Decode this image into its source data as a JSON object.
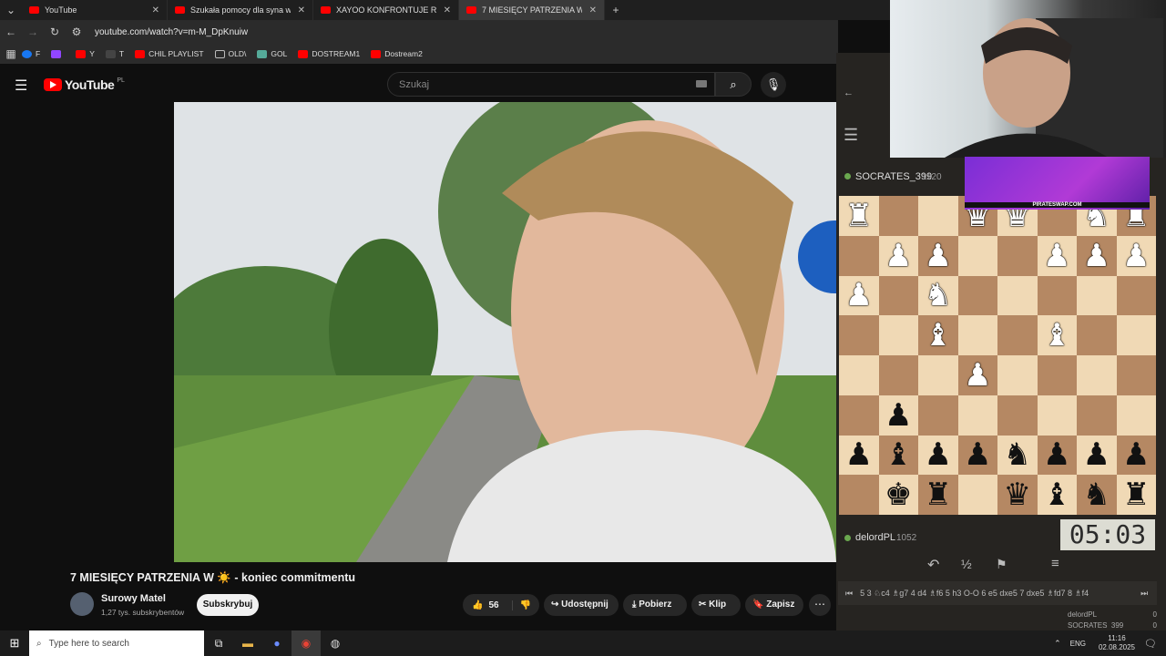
{
  "tabs": [
    {
      "label": "YouTube"
    },
    {
      "label": "Szukała pomocy dla syna w szp"
    },
    {
      "label": "XAYOO KONFRONTUJE RYBSO"
    },
    {
      "label": "7 MIESIĘCY PATRZENIA W"
    }
  ],
  "address": {
    "url": "youtube.com/watch?v=m-M_DpKnuiw"
  },
  "bookmarks": [
    "F",
    "",
    "Y",
    "T",
    "CHIL PLAYLIST",
    "OLD\\",
    "GOL",
    "DOSTREAM1",
    "Dostream2"
  ],
  "youtube": {
    "logo": "YouTube",
    "region": "PL",
    "search_placeholder": "Szukaj",
    "video_title": "7 MIESIĘCY PATRZENIA W ☀️ - koniec commitmentu",
    "channel_name": "Surowy Matel",
    "subscribers": "1,27 tys. subskrybentów",
    "subscribe_label": "Subskrybuj",
    "likes": "56",
    "share_label": "Udostępnij",
    "download_label": "Pobierz",
    "clip_label": "Klip",
    "save_label": "Zapisz"
  },
  "chess": {
    "top_player": "SOCRATES_399",
    "top_rating": "1120",
    "bottom_player": "delordPL",
    "bottom_rating": "1052",
    "clock": "05:03",
    "moves": "5 3 ♘c4 ♗g7 4 d4 ♗f6 5 h3 O-O 6 e5 dxe5 7 dxe5 ♗fd7 8 ♗f4",
    "score_rows": [
      {
        "name": "delordPL",
        "score": "0"
      },
      {
        "name": "SOCRATES_399",
        "score": "0"
      }
    ],
    "ranks": [
      [
        "wR",
        "",
        "",
        "wQ",
        "wQ",
        "",
        "wN",
        "wR"
      ],
      [
        "",
        "wP",
        "wP",
        "",
        "",
        "wP",
        "wP",
        "wP"
      ],
      [
        "wP",
        "",
        "wN",
        "",
        "",
        "",
        "",
        ""
      ],
      [
        "",
        "",
        "wB",
        "",
        "",
        "wB",
        "",
        ""
      ],
      [
        "",
        "",
        "",
        "wP",
        "",
        "",
        "",
        ""
      ],
      [
        "",
        "bP",
        "",
        "",
        "",
        "",
        "",
        ""
      ],
      [
        "bP",
        "bB",
        "bP",
        "bP",
        "bN",
        "bP",
        "bP",
        "bP"
      ],
      [
        "",
        "bK",
        "bR",
        "",
        "bQ",
        "bB",
        "bN",
        "bR"
      ]
    ]
  },
  "ad": {
    "text": "PIRATESWAP.COM"
  },
  "taskbar": {
    "search_placeholder": "Type here to search",
    "lang": "ENG",
    "time": "11:16",
    "date": "02.08.2025"
  }
}
